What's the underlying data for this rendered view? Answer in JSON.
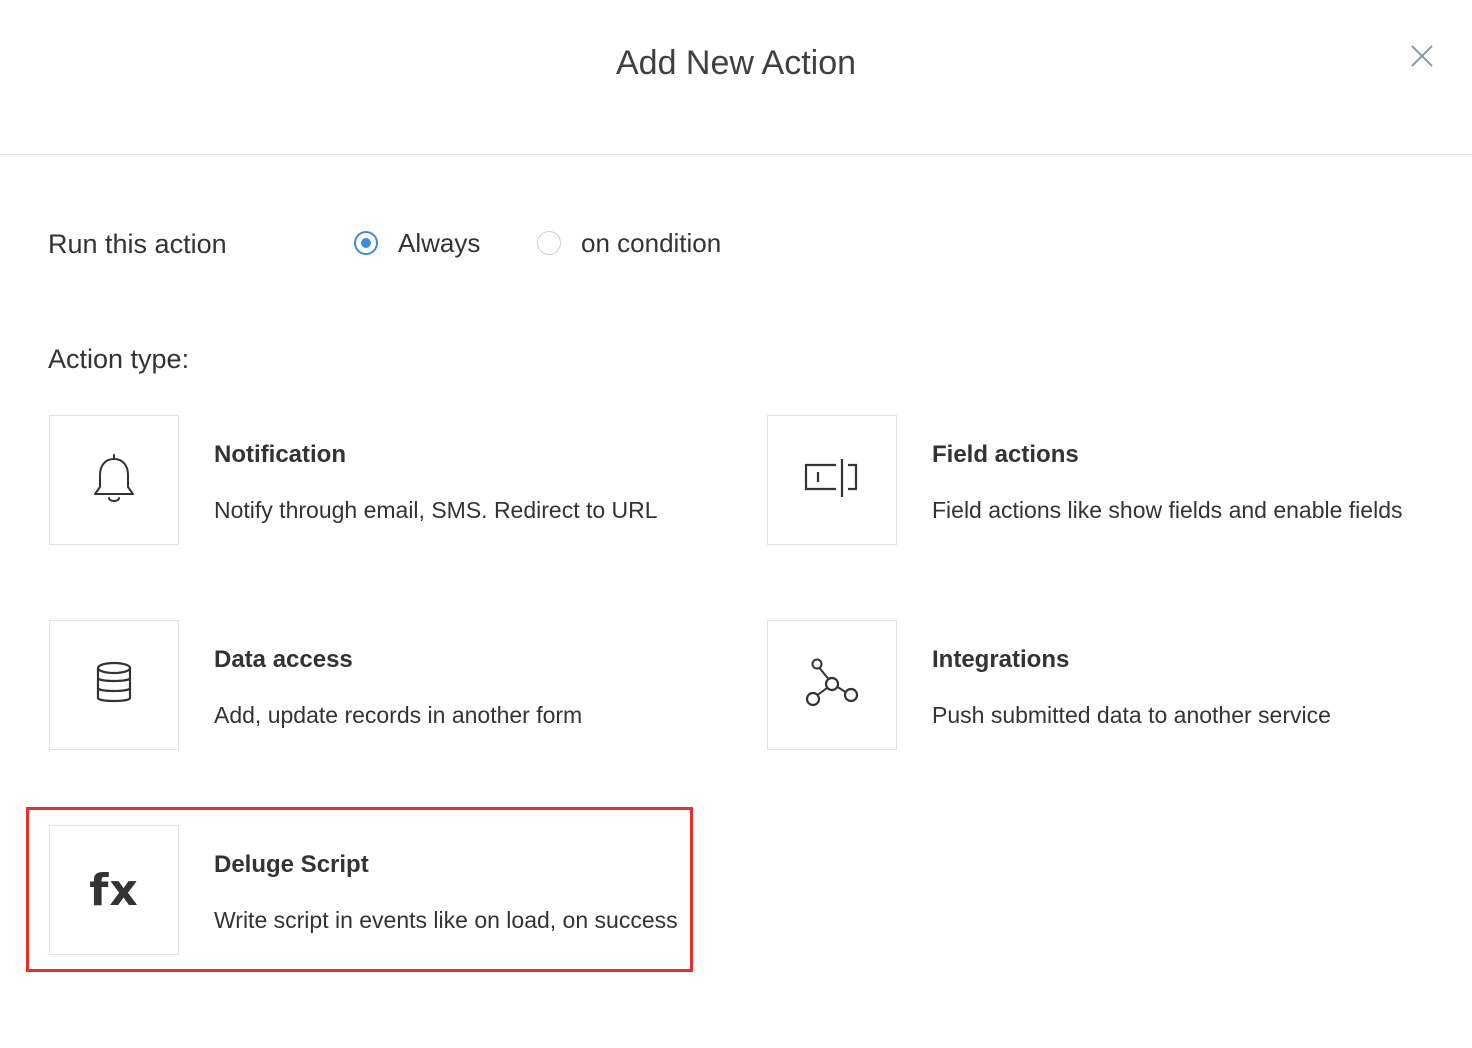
{
  "dialog": {
    "title": "Add New Action",
    "close_icon": "close-icon"
  },
  "run": {
    "label": "Run this action",
    "options": [
      {
        "label": "Always",
        "selected": true
      },
      {
        "label": "on condition",
        "selected": false
      }
    ],
    "accent_color": "#3c8ddb"
  },
  "action_type": {
    "label": "Action type:",
    "cards": [
      {
        "icon": "bell-icon",
        "title": "Notification",
        "description": "Notify through email, SMS. Redirect to URL"
      },
      {
        "icon": "field-actions-icon",
        "title": "Field actions",
        "description": "Field actions like show fields and enable fields"
      },
      {
        "icon": "database-icon",
        "title": "Data access",
        "description": "Add, update records in another form"
      },
      {
        "icon": "integrations-icon",
        "title": "Integrations",
        "description": "Push submitted data to another service"
      },
      {
        "icon": "fx-icon",
        "icon_text": "fx",
        "title": "Deluge Script",
        "description": "Write script in events like on load, on success"
      }
    ]
  },
  "highlight": {
    "target": "Deluge Script",
    "color": "#e8302a"
  }
}
